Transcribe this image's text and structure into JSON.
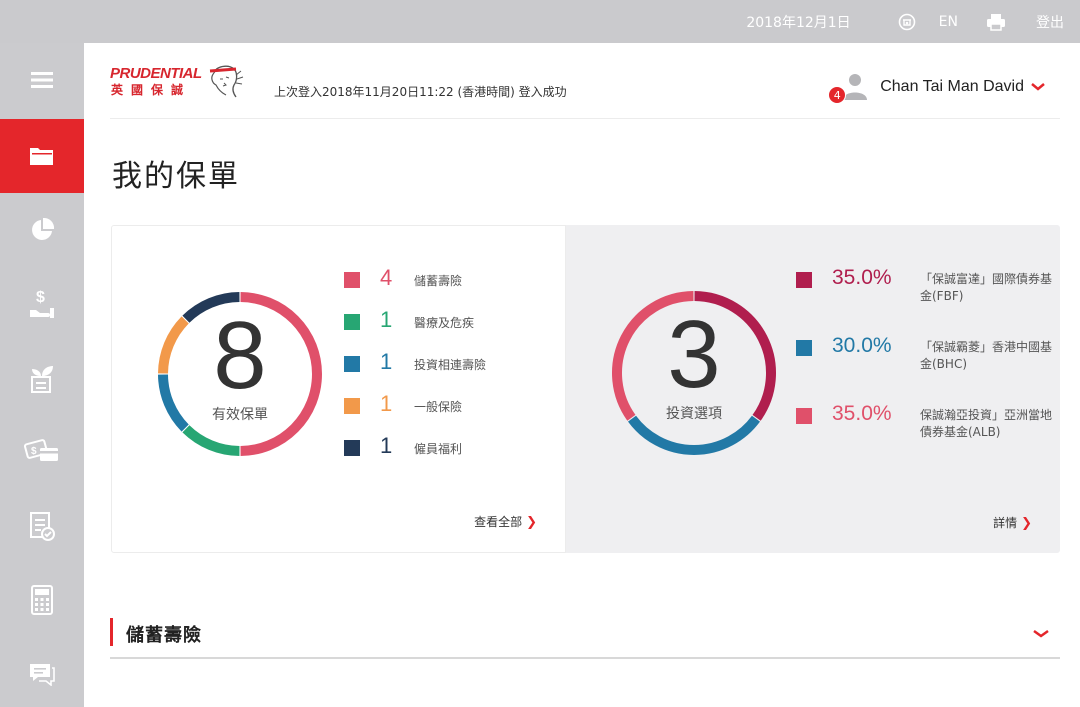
{
  "topbar": {
    "date": "2018年12月1日",
    "lang": "EN",
    "logout": "登出",
    "icons": [
      "hotline-icon",
      "printer-icon"
    ]
  },
  "sidebar": {
    "items": [
      {
        "name": "menu-icon",
        "active": false
      },
      {
        "name": "folder-icon",
        "active": true
      },
      {
        "name": "pie-chart-icon",
        "active": false
      },
      {
        "name": "dollar-hand-icon",
        "active": false
      },
      {
        "name": "plant-document-icon",
        "active": false
      },
      {
        "name": "cash-card-icon",
        "active": false
      },
      {
        "name": "checklist-icon",
        "active": false
      },
      {
        "name": "calculator-icon",
        "active": false
      },
      {
        "name": "chat-icon",
        "active": false
      }
    ],
    "active_color": "#e4262b"
  },
  "header": {
    "logo": {
      "brand": "PRUDENTIAL",
      "sub": "英國保誠"
    },
    "last_login": "上次登入2018年11月20日11:22 (香港時間) 登入成功",
    "user": {
      "name": "Chan Tai Man David",
      "notifications": "4"
    }
  },
  "page": {
    "title": "我的保單"
  },
  "policies": {
    "total": "8",
    "label": "有效保單",
    "items": [
      {
        "count": "4",
        "label": "儲蓄壽險",
        "color": "#e0506a"
      },
      {
        "count": "1",
        "label": "醫療及危疾",
        "color": "#27a673"
      },
      {
        "count": "1",
        "label": "投資相連壽險",
        "color": "#2279a6"
      },
      {
        "count": "1",
        "label": "一般保險",
        "color": "#f2994a"
      },
      {
        "count": "1",
        "label": "僱員福利",
        "color": "#233a58"
      }
    ],
    "view_all": "查看全部"
  },
  "investments": {
    "total": "3",
    "label": "投資選項",
    "funds": [
      {
        "pct": "35.0%",
        "value": 35.0,
        "name": "「保誠富達」國際債券基金(FBF)",
        "color": "#b01e4e"
      },
      {
        "pct": "30.0%",
        "value": 30.0,
        "name": "「保誠霸菱」香港中國基金(BHC)",
        "color": "#2279a6"
      },
      {
        "pct": "35.0%",
        "value": 35.0,
        "name": "保誠瀚亞投資」亞洲當地債券基金(ALB)",
        "color": "#e0506a"
      }
    ],
    "details": "詳情"
  },
  "accordion": {
    "title": "儲蓄壽險"
  }
}
